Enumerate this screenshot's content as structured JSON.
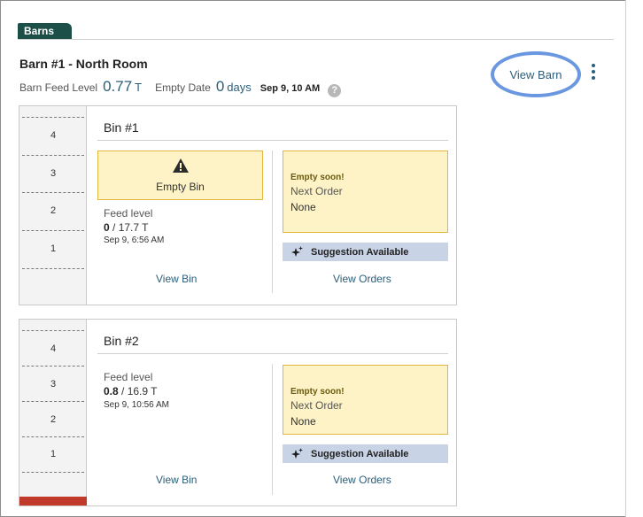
{
  "tabs": {
    "barns_label": "Barns"
  },
  "barn": {
    "title": "Barn #1 - North Room",
    "feed_level_label": "Barn Feed Level",
    "feed_level_value": "0.77",
    "feed_level_unit": "T",
    "empty_date_label": "Empty Date",
    "empty_days_value": "0",
    "empty_days_unit": "days",
    "empty_date": "Sep 9, 10 AM",
    "view_barn_label": "View Barn",
    "help_icon": "?"
  },
  "bins": [
    {
      "title": "Bin #1",
      "gauge_labels": [
        "4",
        "3",
        "2",
        "1"
      ],
      "gauge_fill_fraction": 0,
      "empty_alert": "Empty Bin",
      "feed_level_label": "Feed level",
      "feed_current": "0",
      "feed_capacity": "/ 17.7 T",
      "feed_updated": "Sep 9, 6:56 AM",
      "order_alert": "Empty soon!",
      "next_order_label": "Next Order",
      "next_order_value": "None",
      "suggestion_label": "Suggestion Available",
      "view_bin_label": "View Bin",
      "view_orders_label": "View Orders"
    },
    {
      "title": "Bin #2",
      "gauge_labels": [
        "4",
        "3",
        "2",
        "1"
      ],
      "gauge_fill_fraction": 0.047,
      "feed_level_label": "Feed level",
      "feed_current": "0.8",
      "feed_capacity": "/ 16.9 T",
      "feed_updated": "Sep 9, 10:56 AM",
      "order_alert": "Empty soon!",
      "next_order_label": "Next Order",
      "next_order_value": "None",
      "suggestion_label": "Suggestion Available",
      "view_bin_label": "View Bin",
      "view_orders_label": "View Orders"
    }
  ],
  "colors": {
    "tab_bg": "#1d4f49",
    "link": "#2a5e7a",
    "alert_bg": "#fdf3c6",
    "alert_border": "#e0b640",
    "suggestion_bg": "#c9d3e6",
    "gauge_fill": "#c0392b",
    "highlight_ring": "#6b96e0"
  },
  "icons": {
    "warning": "warning-triangle-icon",
    "sparkle": "sparkle-icon",
    "kebab": "kebab-menu-icon",
    "help": "help-circle-icon"
  }
}
